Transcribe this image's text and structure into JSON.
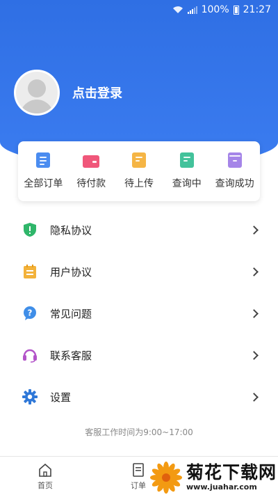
{
  "status_bar": {
    "battery": "100%",
    "time": "21:27"
  },
  "profile": {
    "login_label": "点击登录"
  },
  "orders": [
    {
      "label": "全部订单",
      "icon": "all-orders-icon",
      "color": "#4a8cf0"
    },
    {
      "label": "待付款",
      "icon": "pending-payment-icon",
      "color": "#f0577a"
    },
    {
      "label": "待上传",
      "icon": "pending-upload-icon",
      "color": "#f5b545"
    },
    {
      "label": "查询中",
      "icon": "querying-icon",
      "color": "#43c29b"
    },
    {
      "label": "查询成功",
      "icon": "query-success-icon",
      "color": "#a585e8"
    }
  ],
  "menu": [
    {
      "label": "隐私协议",
      "icon": "shield-icon",
      "color": "#2fb66a"
    },
    {
      "label": "用户协议",
      "icon": "clipboard-icon",
      "color": "#f3b23a"
    },
    {
      "label": "常见问题",
      "icon": "question-icon",
      "color": "#3f8ee8"
    },
    {
      "label": "联系客服",
      "icon": "headset-icon",
      "color": "#b354c9"
    },
    {
      "label": "设置",
      "icon": "gear-icon",
      "color": "#2f78d8"
    }
  ],
  "service_hours": "客服工作时间为9:00~17:00",
  "tabs": [
    {
      "label": "首页",
      "icon": "home-icon"
    },
    {
      "label": "订单",
      "icon": "order-icon"
    }
  ],
  "watermark": {
    "title": "菊花下载网",
    "url": "www.juahar.com"
  }
}
